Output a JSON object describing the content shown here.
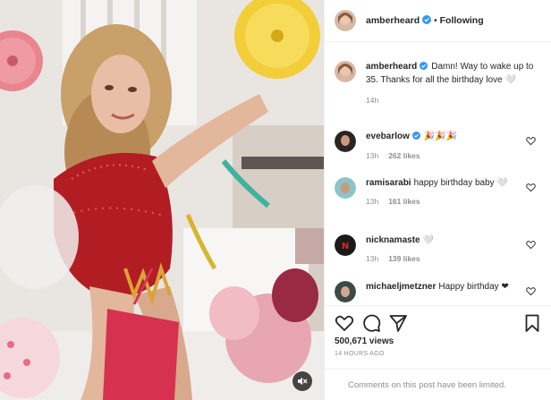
{
  "media": {
    "mute_icon": "speaker-muted-icon"
  },
  "post": {
    "author": "amberheard",
    "follow_state": "Following",
    "separator": "•",
    "verified_icon": "verified-badge-icon",
    "caption": "Damn! Way to wake up to 35. Thanks for all the birthday love 🤍",
    "caption_age": "14h"
  },
  "comments": [
    {
      "user": "evebarlow",
      "verified": true,
      "text": "🎉🎉🎉",
      "age": "13h",
      "likes": "262 likes"
    },
    {
      "user": "ramisarabi",
      "verified": false,
      "text": "happy birthday baby 🤍",
      "age": "13h",
      "likes": "161 likes"
    },
    {
      "user": "nicknamaste",
      "verified": false,
      "text": "🤍",
      "age": "13h",
      "likes": "139 likes"
    },
    {
      "user": "michaeljmetzner",
      "verified": false,
      "text": "Happy birthday ❤",
      "age": "",
      "likes": ""
    }
  ],
  "actions": {
    "icons": [
      "heart-icon",
      "comment-icon",
      "share-icon",
      "bookmark-icon"
    ],
    "views": "500,671 views",
    "post_age": "14 HOURS AGO",
    "comments_limited": "Comments on this post have been limited."
  },
  "colors": {
    "verified_blue": "#3897f0",
    "muted_text": "#8e8e8e",
    "border": "#efefef"
  }
}
